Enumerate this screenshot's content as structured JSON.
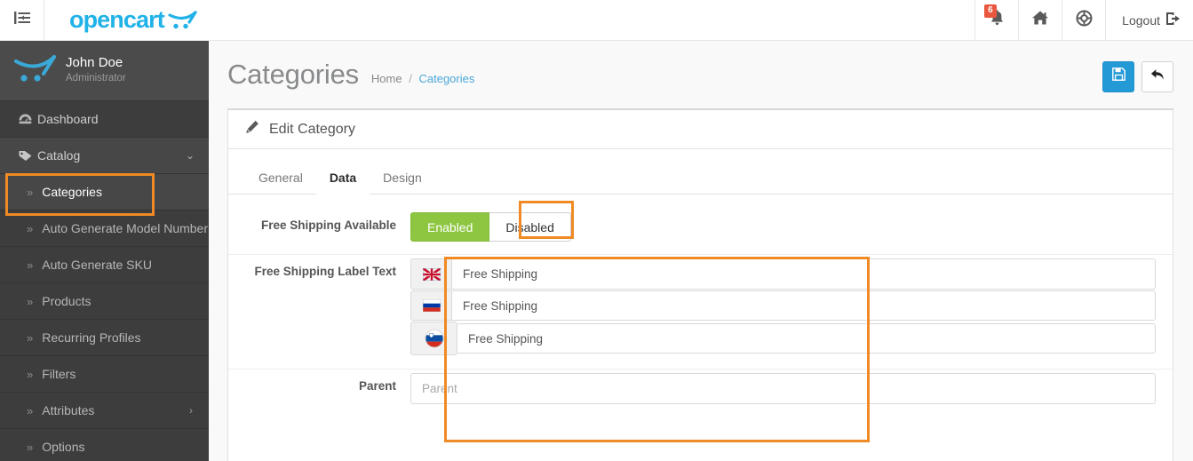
{
  "topbar": {
    "menu_toggle_icon": "hamburger-menu-icon",
    "brand": "opencart",
    "brand_cart_icon": "shopping-cart-icon",
    "notifications": {
      "icon": "bell-icon",
      "count": "6"
    },
    "storefront": {
      "icon": "home-icon"
    },
    "help": {
      "icon": "lifebuoy-icon"
    },
    "logout": {
      "label": "Logout",
      "icon": "logout-icon"
    }
  },
  "sidebar": {
    "profile": {
      "name": "John Doe",
      "role": "Administrator",
      "avatar_icon": "opencart-cart-logo-icon"
    },
    "items": [
      {
        "label": "Dashboard",
        "icon": "dashboard-gauge-icon",
        "level": "top"
      },
      {
        "label": "Catalog",
        "icon": "tag-icon",
        "level": "top",
        "caret": "chevron-down-icon",
        "expanded": true
      },
      {
        "label": "Categories",
        "level": "sub",
        "active": true,
        "chev": "»"
      },
      {
        "label": "Auto Generate Model Number",
        "level": "sub",
        "chev": "»"
      },
      {
        "label": "Auto Generate SKU",
        "level": "sub",
        "chev": "»"
      },
      {
        "label": "Products",
        "level": "sub",
        "chev": "»"
      },
      {
        "label": "Recurring Profiles",
        "level": "sub",
        "chev": "»"
      },
      {
        "label": "Filters",
        "level": "sub",
        "chev": "»"
      },
      {
        "label": "Attributes",
        "level": "sub",
        "chev": "»",
        "caret": "chevron-right-icon"
      },
      {
        "label": "Options",
        "level": "sub",
        "chev": "»"
      }
    ]
  },
  "page": {
    "title": "Categories",
    "breadcrumb": {
      "home": "Home",
      "separator": "/",
      "current": "Categories"
    },
    "actions": {
      "save": {
        "icon": "floppy-disk-save-icon",
        "color": "#239ad6"
      },
      "back": {
        "icon": "back-arrow-icon"
      }
    }
  },
  "panel": {
    "heading": "Edit Category",
    "heading_icon": "pencil-edit-icon",
    "tabs": [
      {
        "label": "General",
        "active": false
      },
      {
        "label": "Data",
        "active": true
      },
      {
        "label": "Design",
        "active": false
      }
    ],
    "form": {
      "free_shipping_available": {
        "label": "Free Shipping Available",
        "enabled_label": "Enabled",
        "disabled_label": "Disabled",
        "selected": "Enabled",
        "enabled_color": "#8ec641"
      },
      "free_shipping_label_text": {
        "label": "Free Shipping Label Text",
        "rows": [
          {
            "flag": "flag-united-kingdom-icon",
            "value": "Free Shipping"
          },
          {
            "flag": "flag-russia-icon",
            "value": "Free Shipping"
          },
          {
            "flag": "flag-slovenia-icon",
            "value": "Free Shipping"
          }
        ]
      },
      "parent": {
        "label": "Parent",
        "value": "",
        "placeholder": "Parent"
      }
    }
  },
  "highlights": {
    "color": "#f08a24",
    "targets": [
      "sidebar-item-categories",
      "tab-data",
      "free-shipping-form-section"
    ]
  }
}
